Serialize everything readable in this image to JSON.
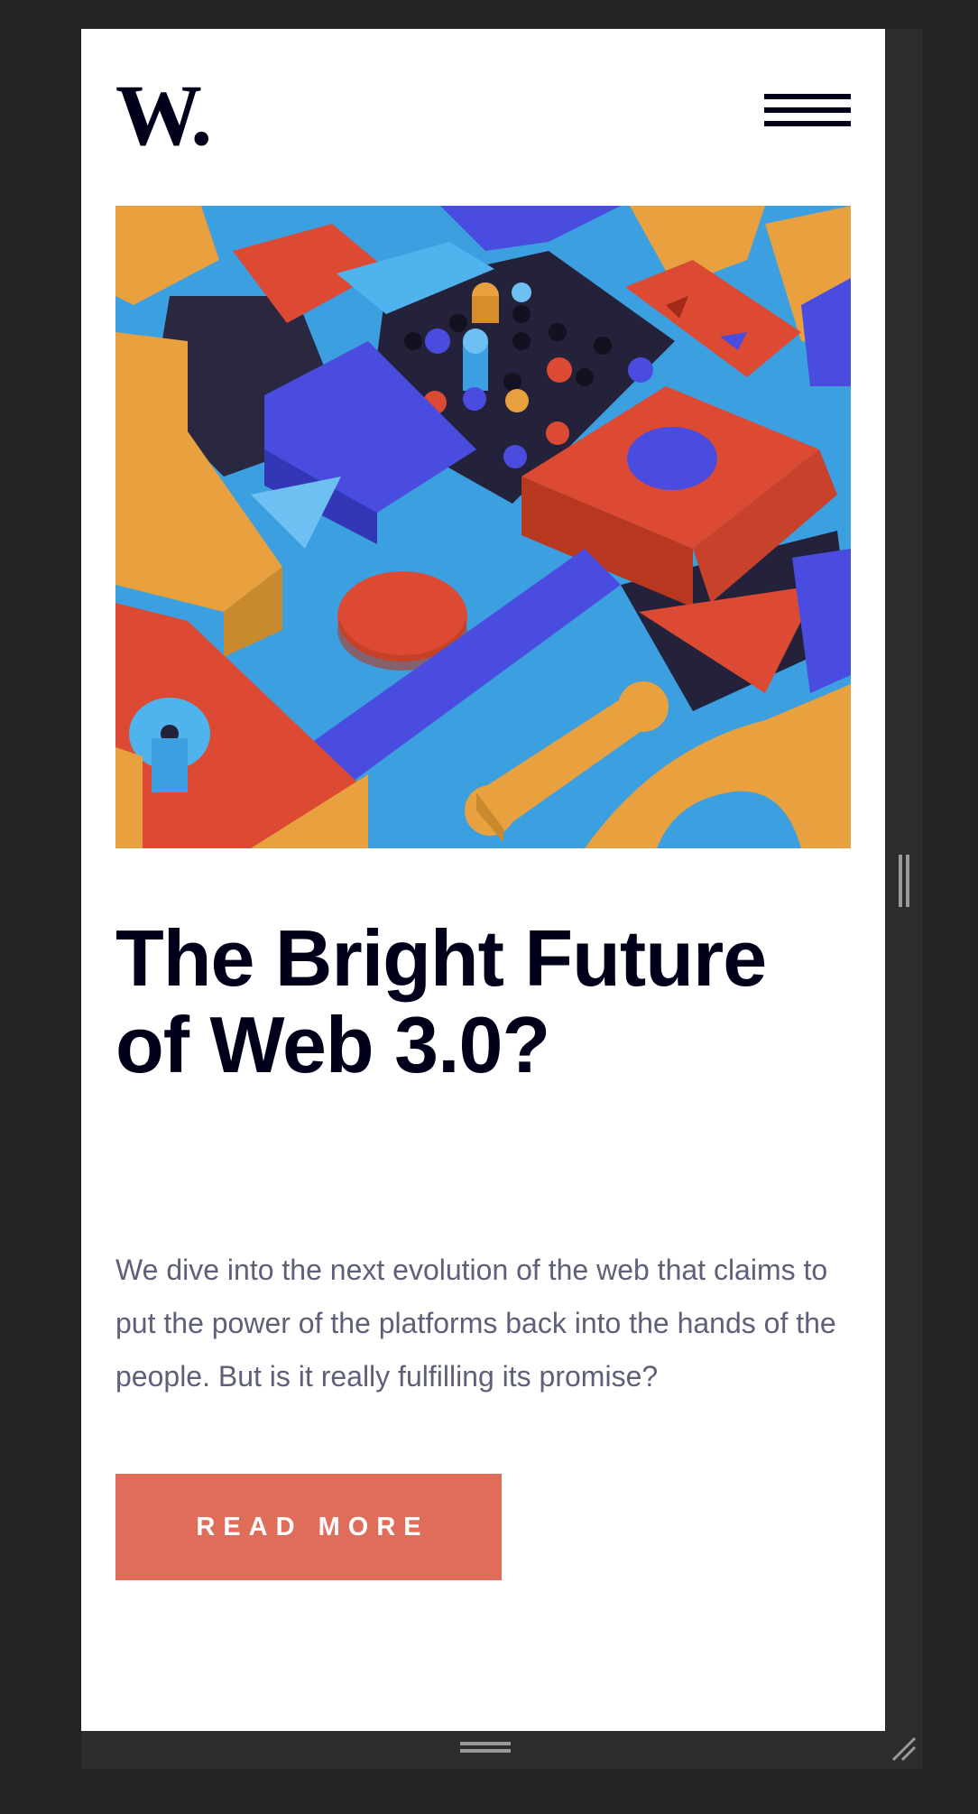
{
  "header": {
    "logo_text": "W.",
    "menu_icon": "hamburger-menu-icon"
  },
  "hero": {
    "image_description_icon": "colorful-3d-blocks-illustration",
    "title": "The Bright Future of Web 3.0?",
    "body": "We dive into the next evolution of the web that claims to put the power of the platforms back into the hands of the people. But is it really fulfilling its promise?",
    "cta_label": "READ MORE"
  },
  "devtools": {
    "side_handle_icon": "resize-handle-vertical-icon",
    "bottom_handle_icon": "resize-handle-horizontal-icon",
    "corner_handle_icon": "resize-corner-icon"
  },
  "colors": {
    "page_background": "#ffffff",
    "chrome_background": "#232325",
    "text_dark": "#00001a",
    "text_muted": "#5e607a",
    "accent": "#e06c5a",
    "art_blue": "#3b9fe0",
    "art_indigo": "#4a4ce0",
    "art_red": "#dd4a33",
    "art_orange": "#e8a13e",
    "art_navy": "#23223a"
  }
}
